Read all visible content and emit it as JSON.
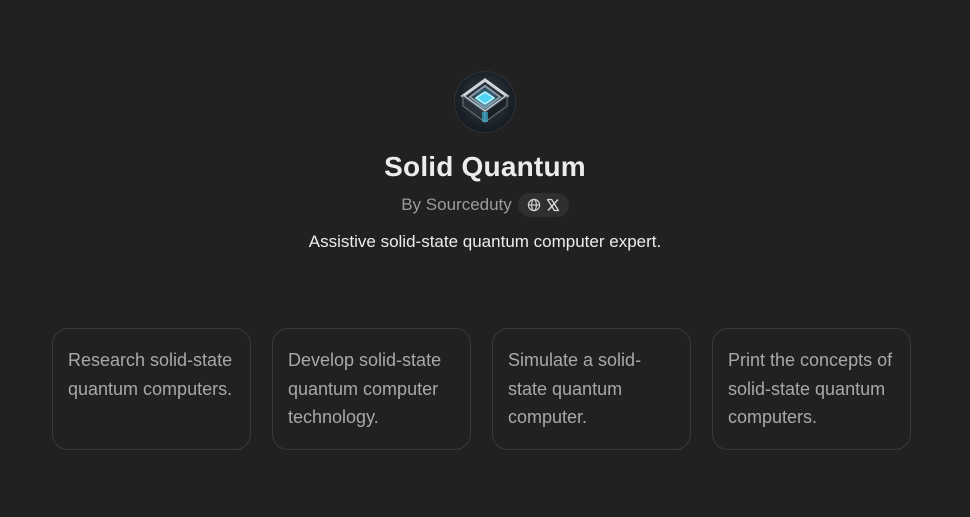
{
  "gpt": {
    "avatar_icon": "layered-cube-logo-icon",
    "title": "Solid Quantum",
    "author": "By Sourceduty",
    "social_icons": [
      "globe-icon",
      "x-logo-icon"
    ],
    "description": "Assistive solid-state quantum computer expert."
  },
  "starters": [
    {
      "text": "Research solid-state quantum computers."
    },
    {
      "text": "Develop solid-state quantum computer technology."
    },
    {
      "text": "Simulate a solid-state quantum computer."
    },
    {
      "text": "Print the concepts of solid-state quantum computers."
    }
  ],
  "colors": {
    "background": "#212121",
    "title": "#ececec",
    "muted": "#9b9b9b",
    "card_border": "#3a3a3a",
    "card_text": "#a8a8a8",
    "pill": "#2f2f2f"
  }
}
